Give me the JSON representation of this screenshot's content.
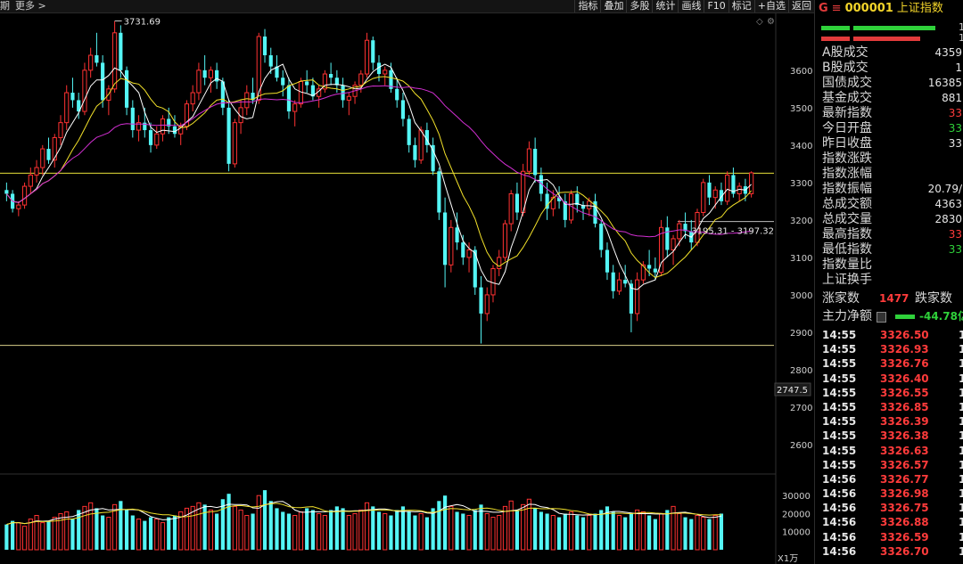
{
  "toolbar": {
    "left": [
      "期",
      "更多 >"
    ],
    "right": [
      "指标",
      "叠加",
      "多股",
      "统计",
      "画线",
      "F10",
      "标记",
      "+自选",
      "返回"
    ]
  },
  "chart_data": {
    "type": "candlestick",
    "price_axis": {
      "ticks": [
        3600,
        3500,
        3400,
        3300,
        3200,
        3100,
        3000,
        2900,
        2800,
        2700,
        2600
      ],
      "current_label": "2747.5",
      "ylim": [
        2550,
        3740
      ]
    },
    "volume_axis": {
      "ticks": [
        30000,
        20000,
        10000
      ],
      "unit_label": "X1万",
      "ylim": [
        0,
        38000
      ]
    },
    "annotations": {
      "high_label": "3731.69",
      "range_label": "3195.31 - 3197.32",
      "hline_upper": 3325,
      "hline_lower": 2865,
      "hline_range": 3196
    },
    "ohlc": [
      [
        3280,
        3300,
        3250,
        3270
      ],
      [
        3270,
        3280,
        3220,
        3230
      ],
      [
        3230,
        3250,
        3210,
        3240
      ],
      [
        3240,
        3300,
        3230,
        3290
      ],
      [
        3290,
        3340,
        3270,
        3320
      ],
      [
        3320,
        3360,
        3300,
        3340
      ],
      [
        3340,
        3400,
        3320,
        3390
      ],
      [
        3390,
        3420,
        3350,
        3360
      ],
      [
        3360,
        3430,
        3340,
        3420
      ],
      [
        3420,
        3480,
        3400,
        3460
      ],
      [
        3460,
        3560,
        3440,
        3540
      ],
      [
        3540,
        3580,
        3500,
        3520
      ],
      [
        3520,
        3540,
        3470,
        3490
      ],
      [
        3490,
        3620,
        3480,
        3600
      ],
      [
        3600,
        3660,
        3580,
        3640
      ],
      [
        3640,
        3700,
        3610,
        3620
      ],
      [
        3620,
        3640,
        3500,
        3520
      ],
      [
        3520,
        3560,
        3480,
        3550
      ],
      [
        3550,
        3731,
        3540,
        3700
      ],
      [
        3700,
        3720,
        3580,
        3600
      ],
      [
        3600,
        3610,
        3480,
        3500
      ],
      [
        3500,
        3520,
        3420,
        3440
      ],
      [
        3440,
        3480,
        3410,
        3460
      ],
      [
        3460,
        3500,
        3420,
        3440
      ],
      [
        3440,
        3460,
        3380,
        3400
      ],
      [
        3400,
        3450,
        3390,
        3430
      ],
      [
        3430,
        3480,
        3410,
        3470
      ],
      [
        3470,
        3500,
        3430,
        3450
      ],
      [
        3450,
        3480,
        3420,
        3430
      ],
      [
        3430,
        3460,
        3400,
        3450
      ],
      [
        3450,
        3520,
        3440,
        3510
      ],
      [
        3510,
        3560,
        3490,
        3540
      ],
      [
        3540,
        3620,
        3520,
        3600
      ],
      [
        3600,
        3640,
        3560,
        3580
      ],
      [
        3580,
        3610,
        3540,
        3600
      ],
      [
        3600,
        3620,
        3550,
        3570
      ],
      [
        3570,
        3580,
        3480,
        3500
      ],
      [
        3500,
        3520,
        3330,
        3350
      ],
      [
        3350,
        3470,
        3340,
        3460
      ],
      [
        3460,
        3520,
        3430,
        3500
      ],
      [
        3500,
        3560,
        3480,
        3540
      ],
      [
        3540,
        3580,
        3510,
        3520
      ],
      [
        3520,
        3700,
        3510,
        3690
      ],
      [
        3690,
        3710,
        3620,
        3640
      ],
      [
        3640,
        3660,
        3590,
        3610
      ],
      [
        3610,
        3640,
        3570,
        3580
      ],
      [
        3580,
        3600,
        3530,
        3560
      ],
      [
        3560,
        3580,
        3470,
        3490
      ],
      [
        3490,
        3520,
        3450,
        3510
      ],
      [
        3510,
        3580,
        3500,
        3570
      ],
      [
        3570,
        3600,
        3540,
        3560
      ],
      [
        3560,
        3580,
        3520,
        3530
      ],
      [
        3530,
        3560,
        3500,
        3550
      ],
      [
        3550,
        3600,
        3540,
        3590
      ],
      [
        3590,
        3620,
        3560,
        3580
      ],
      [
        3580,
        3600,
        3540,
        3560
      ],
      [
        3560,
        3580,
        3500,
        3520
      ],
      [
        3520,
        3540,
        3480,
        3530
      ],
      [
        3530,
        3570,
        3510,
        3560
      ],
      [
        3560,
        3600,
        3540,
        3590
      ],
      [
        3590,
        3700,
        3580,
        3680
      ],
      [
        3680,
        3690,
        3600,
        3620
      ],
      [
        3620,
        3640,
        3570,
        3590
      ],
      [
        3590,
        3610,
        3560,
        3600
      ],
      [
        3600,
        3620,
        3540,
        3550
      ],
      [
        3550,
        3580,
        3500,
        3520
      ],
      [
        3520,
        3540,
        3450,
        3470
      ],
      [
        3470,
        3480,
        3380,
        3400
      ],
      [
        3400,
        3420,
        3340,
        3360
      ],
      [
        3360,
        3450,
        3350,
        3440
      ],
      [
        3440,
        3460,
        3380,
        3400
      ],
      [
        3400,
        3420,
        3320,
        3330
      ],
      [
        3330,
        3340,
        3200,
        3220
      ],
      [
        3220,
        3260,
        3020,
        3080
      ],
      [
        3080,
        3200,
        3060,
        3180
      ],
      [
        3180,
        3220,
        3120,
        3140
      ],
      [
        3140,
        3160,
        3080,
        3100
      ],
      [
        3100,
        3140,
        3060,
        3120
      ],
      [
        3120,
        3130,
        3000,
        3020
      ],
      [
        3020,
        3050,
        2870,
        2950
      ],
      [
        2950,
        3020,
        2930,
        3000
      ],
      [
        3000,
        3080,
        2980,
        3070
      ],
      [
        3070,
        3120,
        3050,
        3100
      ],
      [
        3100,
        3200,
        3090,
        3190
      ],
      [
        3190,
        3280,
        3170,
        3270
      ],
      [
        3270,
        3300,
        3200,
        3220
      ],
      [
        3220,
        3350,
        3210,
        3330
      ],
      [
        3330,
        3410,
        3320,
        3390
      ],
      [
        3390,
        3420,
        3300,
        3320
      ],
      [
        3320,
        3340,
        3250,
        3270
      ],
      [
        3270,
        3300,
        3200,
        3230
      ],
      [
        3230,
        3280,
        3210,
        3260
      ],
      [
        3260,
        3290,
        3230,
        3250
      ],
      [
        3250,
        3270,
        3180,
        3200
      ],
      [
        3200,
        3280,
        3190,
        3270
      ],
      [
        3270,
        3290,
        3220,
        3240
      ],
      [
        3240,
        3250,
        3200,
        3230
      ],
      [
        3230,
        3260,
        3210,
        3250
      ],
      [
        3250,
        3270,
        3180,
        3190
      ],
      [
        3190,
        3200,
        3100,
        3120
      ],
      [
        3120,
        3140,
        3040,
        3060
      ],
      [
        3060,
        3080,
        2990,
        3010
      ],
      [
        3010,
        3060,
        3000,
        3040
      ],
      [
        3040,
        3080,
        3020,
        3030
      ],
      [
        3030,
        3040,
        2900,
        2950
      ],
      [
        2950,
        3060,
        2930,
        3040
      ],
      [
        3040,
        3090,
        3030,
        3080
      ],
      [
        3080,
        3120,
        3050,
        3070
      ],
      [
        3070,
        3100,
        3040,
        3060
      ],
      [
        3060,
        3200,
        3050,
        3180
      ],
      [
        3180,
        3210,
        3100,
        3120
      ],
      [
        3120,
        3160,
        3080,
        3150
      ],
      [
        3150,
        3200,
        3130,
        3190
      ],
      [
        3190,
        3220,
        3150,
        3170
      ],
      [
        3170,
        3200,
        3120,
        3140
      ],
      [
        3140,
        3230,
        3130,
        3220
      ],
      [
        3220,
        3310,
        3210,
        3300
      ],
      [
        3300,
        3320,
        3240,
        3260
      ],
      [
        3260,
        3290,
        3230,
        3280
      ],
      [
        3280,
        3300,
        3240,
        3250
      ],
      [
        3250,
        3330,
        3240,
        3320
      ],
      [
        3320,
        3340,
        3260,
        3270
      ],
      [
        3270,
        3300,
        3250,
        3290
      ],
      [
        3290,
        3310,
        3250,
        3270
      ],
      [
        3270,
        3330,
        3260,
        3326
      ]
    ],
    "volume": [
      14000,
      16000,
      15000,
      13000,
      17000,
      19000,
      15000,
      16000,
      18000,
      20000,
      21000,
      17000,
      22000,
      24000,
      26000,
      23000,
      19000,
      18000,
      25000,
      27000,
      22000,
      19000,
      17000,
      16000,
      18000,
      17000,
      15000,
      18000,
      19000,
      21000,
      23000,
      24000,
      26000,
      25000,
      22000,
      20000,
      28000,
      31000,
      24000,
      22000,
      19000,
      20000,
      30000,
      33000,
      27000,
      23000,
      21000,
      20000,
      19000,
      21000,
      23000,
      22000,
      20000,
      19000,
      22000,
      24000,
      23000,
      19000,
      20000,
      22000,
      26000,
      24000,
      21000,
      20000,
      19000,
      22000,
      24000,
      21000,
      19000,
      20000,
      18000,
      23000,
      27000,
      30000,
      24000,
      21000,
      20000,
      19000,
      22000,
      25000,
      20000,
      18000,
      19000,
      24000,
      27000,
      22000,
      25000,
      28000,
      23000,
      21000,
      20000,
      19000,
      18000,
      20000,
      21000,
      19000,
      18000,
      19000,
      20000,
      22000,
      24000,
      21000,
      19000,
      18000,
      20000,
      22000,
      21000,
      19000,
      17000,
      20000,
      22000,
      24000,
      20000,
      18000,
      17000,
      19000,
      18000,
      17000,
      19000,
      20000
    ]
  },
  "panel": {
    "header": {
      "flag": "G",
      "eq": "≡",
      "code": "000001",
      "name": "上证指数"
    },
    "bars": [
      {
        "color": "#2fd13a",
        "value": 1
      },
      {
        "color": "#e23b3b",
        "value": 1
      }
    ],
    "bar_labels": [
      "1",
      "1"
    ],
    "stats": [
      {
        "label": "A股成交",
        "value": "4359",
        "cls": ""
      },
      {
        "label": "B股成交",
        "value": "1",
        "cls": ""
      },
      {
        "label": "国债成交",
        "value": "16385",
        "cls": ""
      },
      {
        "label": "基金成交",
        "value": "881",
        "cls": ""
      },
      {
        "label": "最新指数",
        "value": "33",
        "cls": "red"
      },
      {
        "label": "今日开盘",
        "value": "33",
        "cls": "green"
      },
      {
        "label": "昨日收盘",
        "value": "33",
        "cls": ""
      },
      {
        "label": "指数涨跌",
        "value": "",
        "cls": ""
      },
      {
        "label": "指数涨幅",
        "value": "",
        "cls": ""
      },
      {
        "label": "指数振幅",
        "value": "20.79/",
        "cls": ""
      },
      {
        "label": "总成交额",
        "value": "4363",
        "cls": ""
      },
      {
        "label": "总成交量",
        "value": "2830",
        "cls": ""
      },
      {
        "label": "最高指数",
        "value": "33",
        "cls": "red"
      },
      {
        "label": "最低指数",
        "value": "33",
        "cls": "green"
      },
      {
        "label": "指数量比",
        "value": "",
        "cls": ""
      },
      {
        "label": "上证换手",
        "value": "",
        "cls": ""
      }
    ],
    "advance": {
      "label": "涨家数",
      "value": "1477",
      "decline_label": "跌家数"
    },
    "netflow": {
      "label": "主力净额",
      "value": "-44.78亿"
    },
    "ticks": [
      {
        "time": "14:55",
        "price": "3326.50"
      },
      {
        "time": "14:55",
        "price": "3326.93"
      },
      {
        "time": "14:55",
        "price": "3326.76"
      },
      {
        "time": "14:55",
        "price": "3326.40"
      },
      {
        "time": "14:55",
        "price": "3326.55"
      },
      {
        "time": "14:55",
        "price": "3326.85"
      },
      {
        "time": "14:55",
        "price": "3326.39"
      },
      {
        "time": "14:55",
        "price": "3326.38"
      },
      {
        "time": "14:55",
        "price": "3326.63"
      },
      {
        "time": "14:55",
        "price": "3326.57"
      },
      {
        "time": "14:56",
        "price": "3326.77"
      },
      {
        "time": "14:56",
        "price": "3326.98"
      },
      {
        "time": "14:56",
        "price": "3326.75"
      },
      {
        "time": "14:56",
        "price": "3326.88"
      },
      {
        "time": "14:56",
        "price": "3326.59"
      },
      {
        "time": "14:56",
        "price": "3326.70"
      }
    ],
    "tick_tail": "1"
  }
}
